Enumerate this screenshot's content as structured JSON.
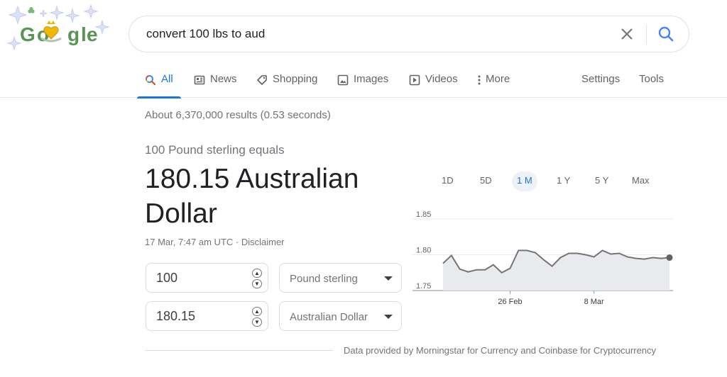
{
  "logo": {
    "text": "Google"
  },
  "search": {
    "query": "convert 100 lbs to aud"
  },
  "tabs": [
    {
      "label": "All",
      "icon": "search-icon",
      "active": true
    },
    {
      "label": "News",
      "icon": "news-icon"
    },
    {
      "label": "Shopping",
      "icon": "tag-icon"
    },
    {
      "label": "Images",
      "icon": "image-icon"
    },
    {
      "label": "Videos",
      "icon": "video-icon"
    },
    {
      "label": "More",
      "icon": "more-vert-icon"
    }
  ],
  "tools": {
    "settings": "Settings",
    "tools": "Tools"
  },
  "stats": "About 6,370,000 results (0.53 seconds)",
  "converter": {
    "equals_text": "100 Pound sterling equals",
    "result_text": "180.15 Australian Dollar",
    "timestamp": "17 Mar, 7:47 am UTC · ",
    "disclaimer": "Disclaimer",
    "from_amount": "100",
    "from_currency": "Pound sterling",
    "to_amount": "180.15",
    "to_currency": "Australian Dollar",
    "credit": "Data provided by Morningstar for Currency and Coinbase for Cryptocurrency"
  },
  "ranges": [
    "1D",
    "5D",
    "1 M",
    "1 Y",
    "5 Y",
    "Max"
  ],
  "active_range": "1 M",
  "colors": {
    "accent": "#1a73e8",
    "line": "#757575",
    "fill": "#e8eaed"
  },
  "chart_data": {
    "type": "area",
    "y_ticks": [
      "1.85",
      "1.80",
      "1.75"
    ],
    "ylim": [
      1.75,
      1.85
    ],
    "x_ticks": [
      {
        "label": "26 Feb",
        "index": 8
      },
      {
        "label": "8 Mar",
        "index": 18
      }
    ],
    "values": [
      1.788,
      1.799,
      1.78,
      1.776,
      1.779,
      1.779,
      1.786,
      1.775,
      1.781,
      1.806,
      1.806,
      1.803,
      1.793,
      1.784,
      1.796,
      1.802,
      1.802,
      1.8,
      1.797,
      1.806,
      1.801,
      1.802,
      1.797,
      1.795,
      1.794,
      1.796,
      1.795,
      1.796
    ]
  }
}
